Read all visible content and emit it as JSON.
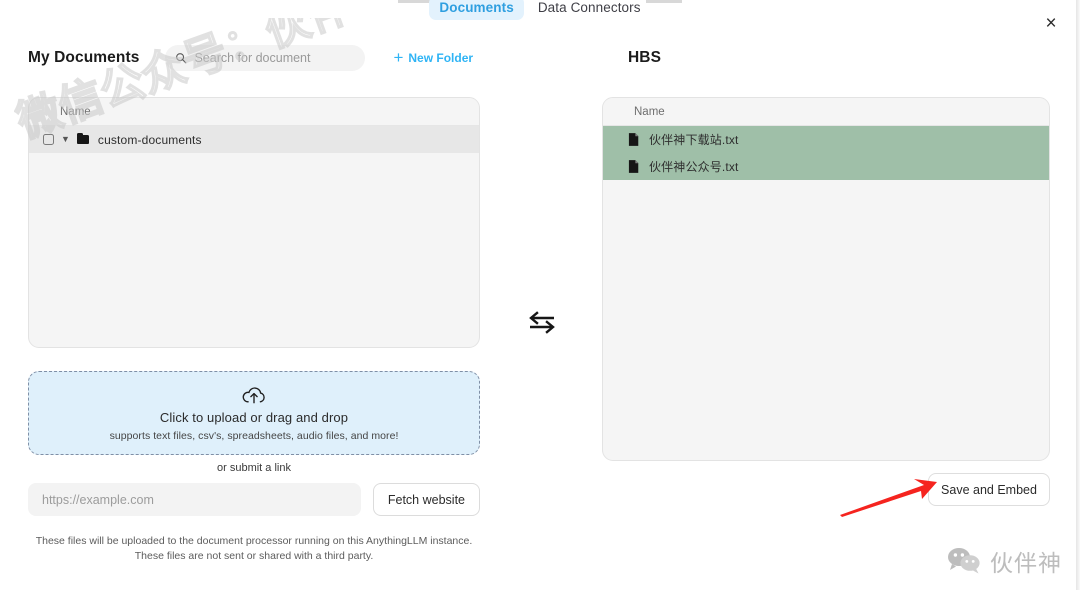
{
  "window": {
    "close_label": "×"
  },
  "tabs": [
    {
      "label": "Documents",
      "active": true
    },
    {
      "label": "Data Connectors",
      "active": false
    }
  ],
  "left_pane": {
    "title": "My Documents",
    "search": {
      "placeholder": "Search for document",
      "value": "",
      "icon": "search-icon"
    },
    "new_folder_label": "New Folder",
    "column_header": "Name",
    "rows": [
      {
        "label": "custom-documents",
        "type": "folder",
        "checked": false,
        "expanded": true
      }
    ]
  },
  "right_pane": {
    "title": "HBS",
    "column_header": "Name",
    "rows": [
      {
        "label": "伙伴神下载站.txt",
        "type": "document",
        "selected": true
      },
      {
        "label": "伙伴神公众号.txt",
        "type": "document",
        "selected": true
      }
    ]
  },
  "transfer": {
    "icon": "transfer-arrows-icon"
  },
  "upload": {
    "icon": "cloud-upload-icon",
    "title": "Click to upload or drag and drop",
    "subtitle": "supports text files, csv's, spreadsheets, audio files, and more!",
    "or_link_label": "or submit a link",
    "url_placeholder": "https://example.com",
    "url_value": "",
    "fetch_label": "Fetch website"
  },
  "disclaimer": {
    "line1": "These files will be uploaded to the document processor running on this AnythingLLM instance.",
    "line2": "These files are not sent or shared with a third party."
  },
  "actions": {
    "save_label": "Save and Embed"
  },
  "watermark": {
    "diagonal_text": "微信公众号：伙伴神",
    "brand_text": "伙伴神"
  },
  "colors": {
    "accent_blue": "#2fb4f5",
    "tab_active_bg": "#e3f2fd",
    "selected_row_green": "#9fbfa8",
    "dropzone_bg": "#dff0fb",
    "annotation_red": "#f5241f"
  }
}
